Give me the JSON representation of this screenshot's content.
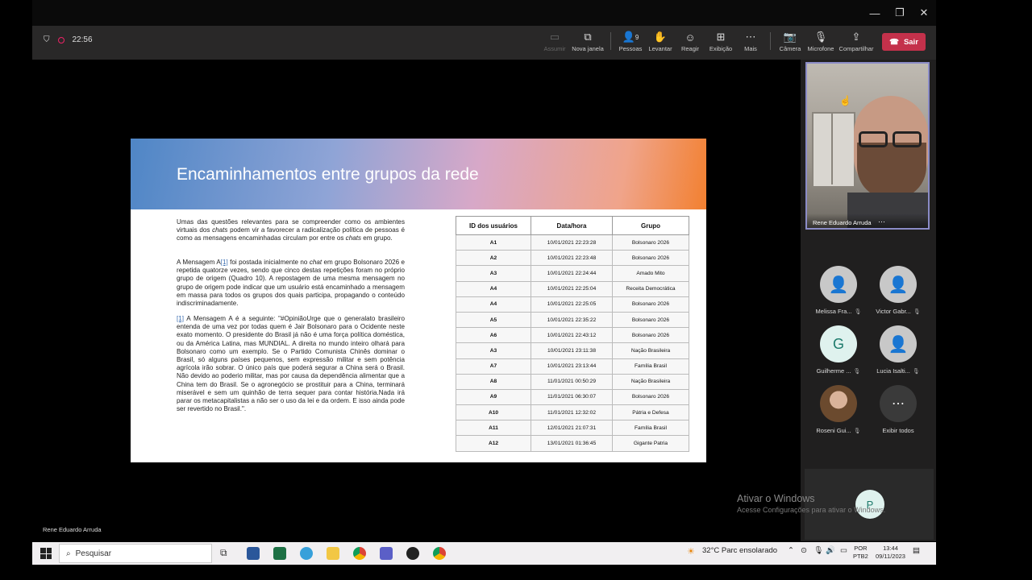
{
  "meeting": {
    "timer": "22:56",
    "toolbar": {
      "assumir": "Assumir",
      "nova_janela": "Nova janela",
      "pessoas": "Pessoas",
      "pessoas_count": "9",
      "levantar": "Levantar",
      "reagir": "Reagir",
      "exibicao": "Exibição",
      "mais": "Mais",
      "camera": "Câmera",
      "microfone": "Microfone",
      "compartilhar": "Compartilhar",
      "sair": "Sair"
    },
    "presenter_name": "Rene Eduardo Arruda",
    "self_video_name": "Rene Eduardo Arruda",
    "participants": [
      {
        "name": "Melissa Fra...",
        "initial": ""
      },
      {
        "name": "Victor Gabr...",
        "initial": ""
      },
      {
        "name": "Guilherme ...",
        "initial": "G"
      },
      {
        "name": "Lucia Isalti...",
        "initial": ""
      },
      {
        "name": "Roseni Gui...",
        "initial": ""
      },
      {
        "name": "Exibir todos",
        "initial": ""
      }
    ],
    "p_tile_initial": "P"
  },
  "slide": {
    "title": "Encaminhamentos entre grupos da rede",
    "p1a": "Umas das questões relevantes para se compreender como os ambientes virtuais dos ",
    "p1_chats": "chats",
    "p1b": " podem vir a favorecer a radicalização política de pessoas é como as mensagens encaminhadas circulam por entre os ",
    "p1_chats2": "chats",
    "p1c": " em grupo.",
    "p2a": "A Mensagem A",
    "p2_note": "[1]",
    "p2b": " foi postada inicialmente no ",
    "p2_chat": "chat",
    "p2c": " em grupo Bolsonaro 2026 e repetida quatorze vezes, sendo que cinco destas repetições foram no próprio grupo de origem (Quadro 10). A repostagem de uma mesma mensagem no grupo de origem pode indicar que um usuário está encaminhado a mensagem em massa para todos os grupos dos quais participa, propagando o conteúdo indiscriminadamente.",
    "p3_note": "[1]",
    "p3": " A Mensagem A é a seguinte: \"#OpiniãoUrge que o generalato brasileiro entenda de uma vez por todas quem é Jair Bolsonaro para o Ocidente neste exato momento. O presidente do Brasil já não é uma força política doméstica, ou da América Latina, mas MUNDIAL. A direita no mundo inteiro olhará para Bolsonaro como um exemplo. Se o Partido Comunista Chinês dominar o Brasil, só alguns países pequenos, sem expressão militar e sem potência agrícola irão sobrar. O único país que poderá segurar a China será o Brasil. Não devido ao poderio militar, mas por causa da dependência alimentar que a China tem do Brasil. Se o agronegócio se prostituir para a China, terminará miserável e sem um quinhão de terra sequer para contar história.Nada irá parar os metacapitalistas a não ser o uso da lei e da ordem. E isso ainda pode ser revertido no Brasil.\".",
    "table": {
      "headers": [
        "ID dos usuários",
        "Data/hora",
        "Grupo"
      ],
      "rows": [
        [
          "A1",
          "10/01/2021 22:23:28",
          "Bolsonaro 2026"
        ],
        [
          "A2",
          "10/01/2021 22:23:48",
          "Bolsonaro 2026"
        ],
        [
          "A3",
          "10/01/2021 22:24:44",
          "Amado Mito"
        ],
        [
          "A4",
          "10/01/2021 22:25:04",
          "Receita Democrática"
        ],
        [
          "A4",
          "10/01/2021 22:25:05",
          "Bolsonaro 2026"
        ],
        [
          "A5",
          "10/01/2021 22:35:22",
          "Bolsonaro 2026"
        ],
        [
          "A6",
          "10/01/2021 22:43:12",
          "Bolsonaro 2026"
        ],
        [
          "A3",
          "10/01/2021 23:11:38",
          "Nação Brasileira"
        ],
        [
          "A7",
          "10/01/2021 23:13:44",
          "Família Brasil"
        ],
        [
          "A8",
          "11/01/2021 00:50:29",
          "Nação Brasileira"
        ],
        [
          "A9",
          "11/01/2021 06:30:07",
          "Bolsonaro 2026"
        ],
        [
          "A10",
          "11/01/2021 12:32:02",
          "Pátria e Defesa"
        ],
        [
          "A11",
          "12/01/2021 21:07:31",
          "Família Brasil"
        ],
        [
          "A12",
          "13/01/2021 01:36:45",
          "Gigante Patria"
        ]
      ]
    }
  },
  "windows": {
    "watermark_title": "Ativar o Windows",
    "watermark_sub": "Acesse Configurações para ativar o Windows.",
    "search_placeholder": "Pesquisar",
    "weather": "32°C  Parc ensolarado",
    "lang1": "POR",
    "lang2": "PTB2",
    "time": "13:44",
    "date": "09/11/2023"
  },
  "colors": {
    "accent_purple": "#8b8cc7",
    "leave_red": "#c4314b"
  }
}
